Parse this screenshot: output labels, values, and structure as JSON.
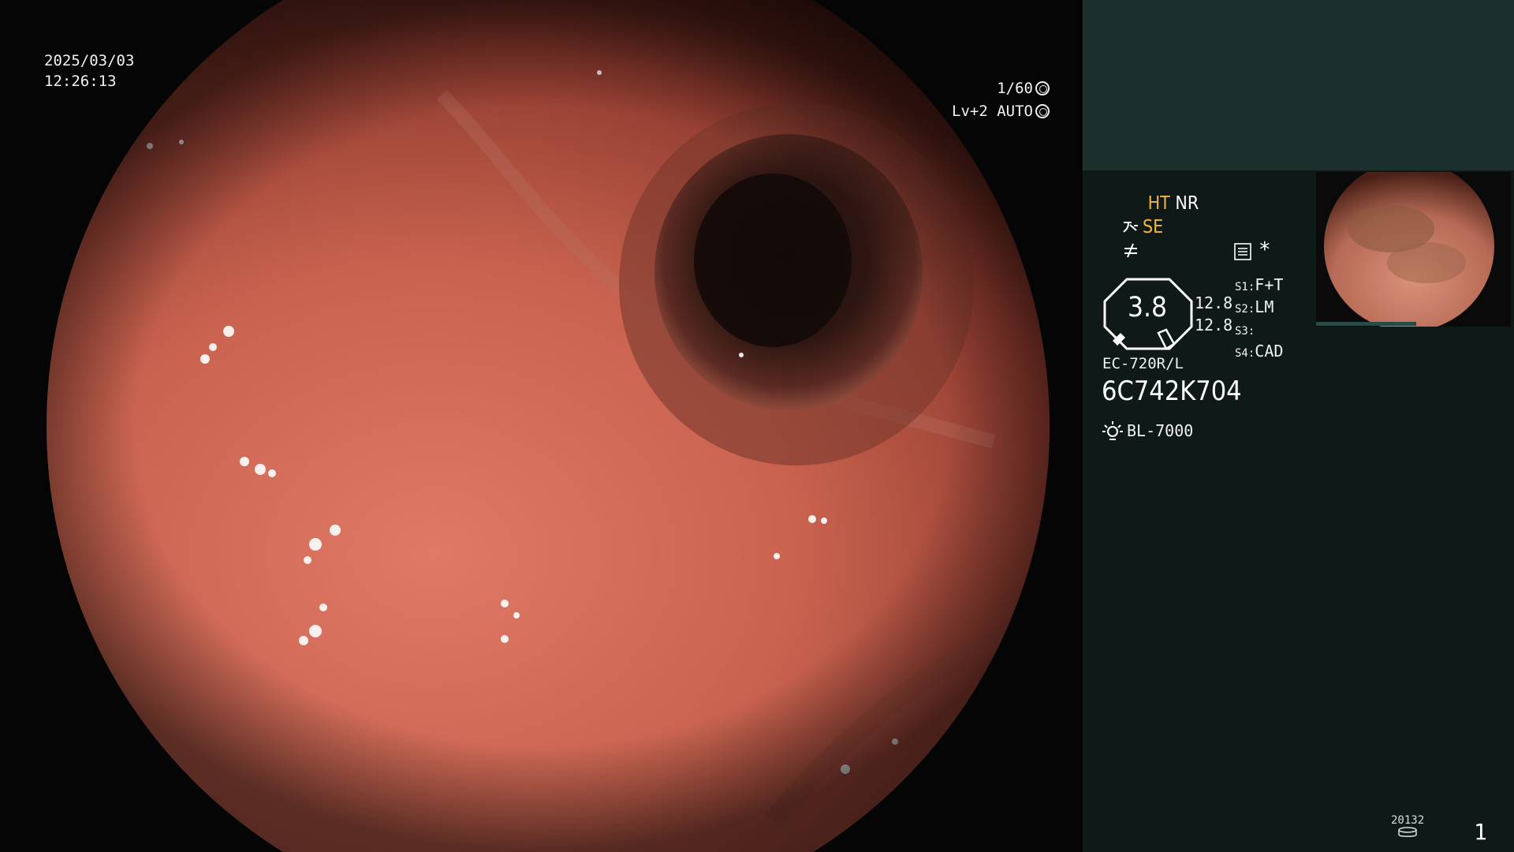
{
  "view": {
    "date": "2025/03/03",
    "time": "12:26:13",
    "shutter": "1/60",
    "iris": "Lv+2 AUTO"
  },
  "panel": {
    "mode_ht": "HT",
    "mode_nr": "NR",
    "mode_se": "SE",
    "zoom_value": "3.8",
    "val_a": "12.8",
    "val_b": "12.8",
    "slots": [
      {
        "key": "S1",
        "value": "F+T"
      },
      {
        "key": "S2",
        "value": "LM"
      },
      {
        "key": "S3",
        "value": ""
      },
      {
        "key": "S4",
        "value": "CAD"
      }
    ],
    "scope_model": "EC-720R/L",
    "scope_serial": "6C742K704",
    "light_source": "BL-7000",
    "counter": "20132",
    "page_number": "1"
  },
  "colors": {
    "panel_bg": "#0f1a18",
    "panel_top_bg": "#1a2e2b",
    "accent_yellow": "#f0b840"
  }
}
